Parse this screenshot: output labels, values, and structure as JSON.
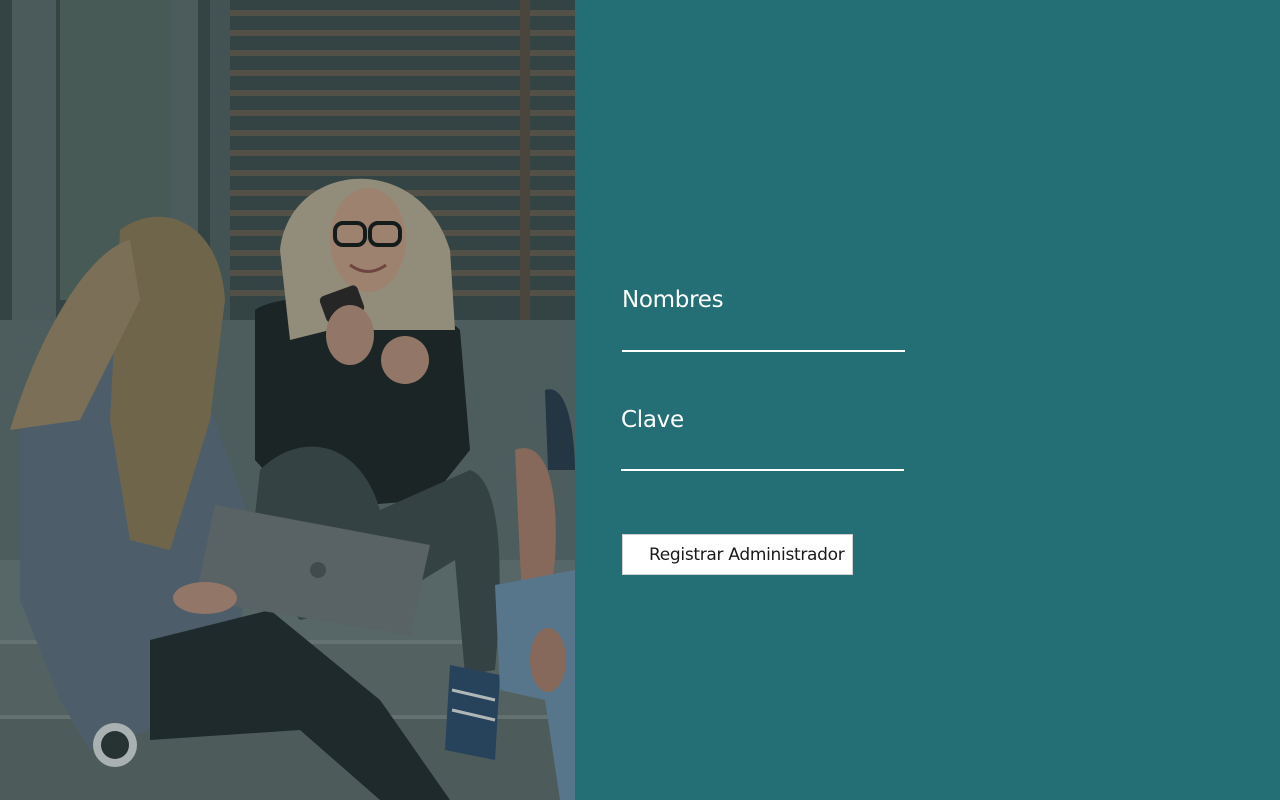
{
  "login_form": {
    "name_label": "Nombres",
    "name_value": "",
    "password_label": "Clave",
    "password_value": "",
    "submit_label": "Registrar Administrador"
  },
  "colors": {
    "panel_background": "#236f75",
    "field_text": "#ffffff",
    "button_background": "#ffffff",
    "button_text": "#1a1a1a"
  },
  "hero_image": {
    "description_icon": "students-photo"
  }
}
